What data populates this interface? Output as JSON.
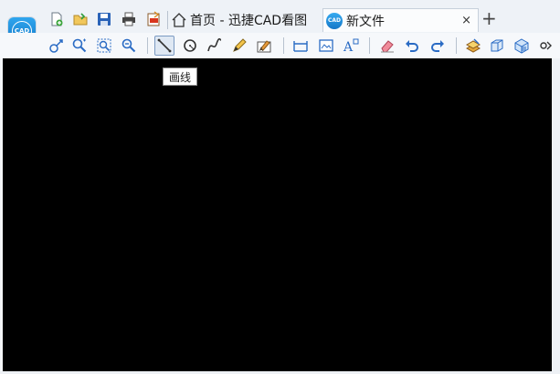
{
  "app": {
    "logo_text": "CAD"
  },
  "tabs": [
    {
      "label": "首页 - 迅捷CAD看图",
      "active": false
    },
    {
      "label": "新文件",
      "active": true,
      "icon_text": "CAD"
    }
  ],
  "tab_close": "×",
  "tab_add": "+",
  "quick_access": [
    {
      "name": "new-file-icon"
    },
    {
      "name": "open-folder-icon"
    },
    {
      "name": "save-icon"
    },
    {
      "name": "print-icon"
    },
    {
      "name": "export-pdf-icon"
    }
  ],
  "toolbar": [
    "pan-icon",
    "zoom-window-icon",
    "zoom-extents-icon",
    "zoom-previous-icon",
    "draw-line-icon",
    "draw-circle-icon",
    "draw-spline-icon",
    "draw-pencil-icon",
    "draw-eraser-box-icon",
    "measure-icon",
    "layout-icon",
    "text-icon",
    "erase-icon",
    "undo-icon",
    "redo-icon",
    "layer-icon",
    "3d-box-icon",
    "3d-view-icon",
    "more-icon"
  ],
  "tooltip": {
    "text": "画线"
  },
  "colors": {
    "canvas": "#000000",
    "accent": "#1b86d8",
    "toolbar_bg": "#f6f8fb"
  }
}
